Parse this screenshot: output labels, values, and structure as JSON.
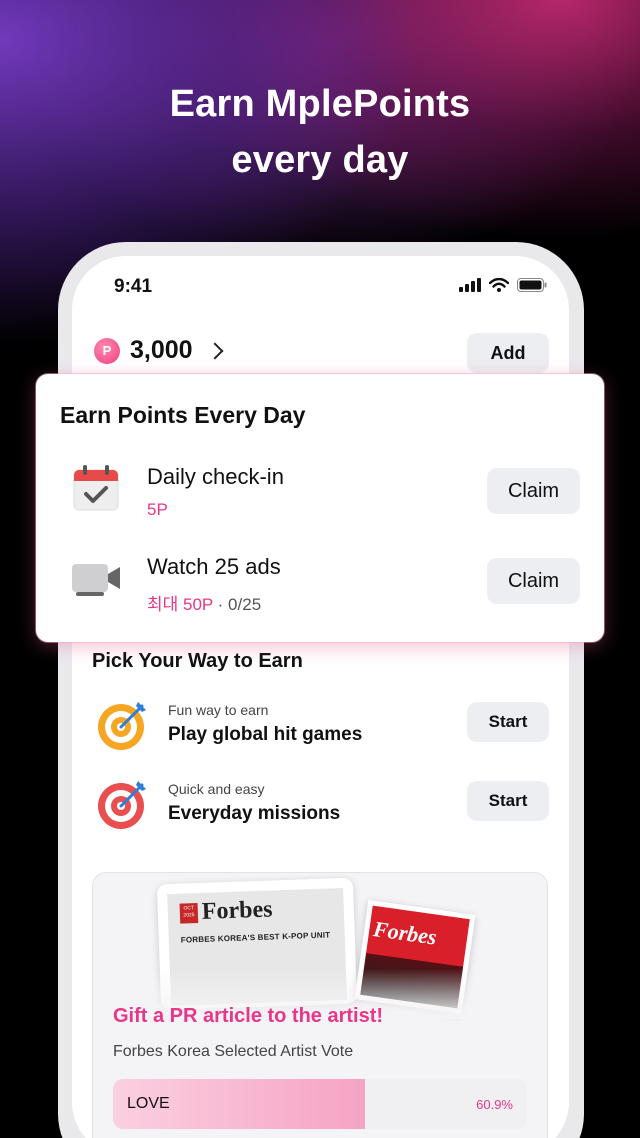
{
  "headline": {
    "line1": "Earn MplePoints",
    "line2": "every day"
  },
  "status_bar": {
    "time": "9:41"
  },
  "wallet": {
    "badge": "P",
    "points": "3,000",
    "add_label": "Add"
  },
  "earn_card": {
    "title": "Earn Points Every Day",
    "items": [
      {
        "name": "Daily check-in",
        "reward": "5P",
        "progress": "",
        "action": "Claim",
        "icon": "calendar-check-icon"
      },
      {
        "name": "Watch 25 ads",
        "reward": "최대 50P",
        "progress": " · 0/25",
        "action": "Claim",
        "icon": "video-camera-icon"
      }
    ]
  },
  "pick": {
    "title": "Pick Your Way to Earn",
    "items": [
      {
        "small": "Fun way to earn",
        "big": "Play global hit games",
        "action": "Start",
        "icon": "yellow-target-icon"
      },
      {
        "small": "Quick and easy",
        "big": "Everyday missions",
        "action": "Start",
        "icon": "red-target-icon"
      }
    ]
  },
  "gift": {
    "magazine_left": {
      "brand": "Forbes",
      "date": "OCT 2025",
      "headline": "FORBES KOREA'S BEST K-POP UNIT"
    },
    "magazine_right": {
      "brand": "Forbes"
    },
    "title": "Gift a PR article to the artist!",
    "subtitle": "Forbes Korea Selected Artist Vote",
    "vote": {
      "label": "LOVE",
      "percent_text": "60.9%",
      "fraction": 0.609
    }
  },
  "colors": {
    "accent": "#e8368a",
    "button_bg": "#eceef1"
  }
}
